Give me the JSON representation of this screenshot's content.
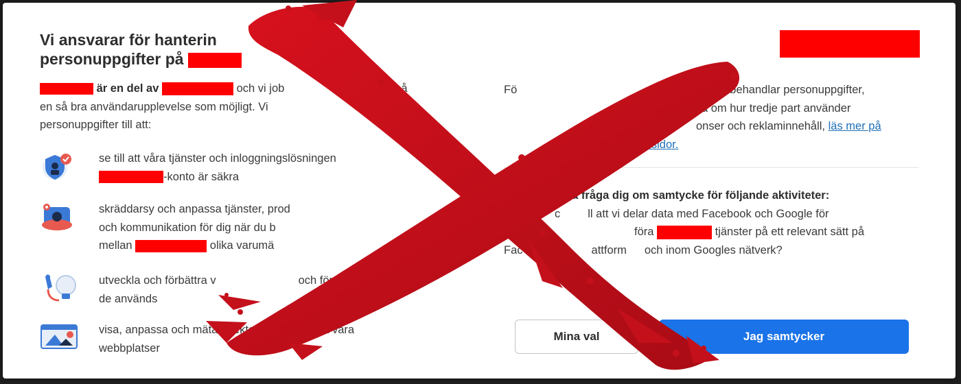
{
  "colors": {
    "redaction": "#ff0000",
    "primary_button": "#1a73e8",
    "link": "#1f6fb8",
    "overlay_x": "#c8101c"
  },
  "dialog": {
    "title_line1": "Vi ansvarar för hanterin",
    "title_line2": "personuppgifter på"
  },
  "intro": {
    "part1": "är en del av",
    "part2": "och vi job",
    "part3": "å",
    "line2": "en så bra användarupplevelse som möjligt. Vi",
    "line3": "personuppgifter till att:"
  },
  "purposes": [
    {
      "icon": "security-shield-icon",
      "line1": "se till att våra tjänster och inloggningslösningen",
      "line2_after": "-konto är säkra"
    },
    {
      "icon": "personalize-chat-icon",
      "line1": "skräddarsy och anpassa tjänster, prod",
      "line2": "och kommunikation för dig när du b",
      "line3_before": "mellan",
      "line3_after": "olika varumä"
    },
    {
      "icon": "improve-lightbulb-icon",
      "line1": "utveckla och förbättra v",
      "line1_tail": "och förstå hur",
      "line2": "de används"
    },
    {
      "icon": "advertising-screen-icon",
      "line1": "visa, anpassa och mäta effekten av reklam på våra",
      "line2": "webbplatser"
    }
  ],
  "right": {
    "line1_start": "Fö",
    "line1_end": "behandlar personuppgifter,",
    "line2_end": "a om hur tredje part använder",
    "line3_end": "onser och reklaminnehåll,",
    "link_line3": "läs mer på",
    "link_line4": "yddssidor."
  },
  "consent": {
    "question_bold": "så fråga dig om samtycke för följande aktiviteter:",
    "line2_start": "c",
    "line2_end": "ll att vi delar data med Facebook och Google för",
    "line3_mid": "föra",
    "line3_end": "tjänster på ett relevant sätt på",
    "line4_start": "Fac",
    "line4_mid": "attform",
    "line4_end": "och inom Googles nätverk?"
  },
  "buttons": {
    "my_choices": "Mina val",
    "accept": "Jag samtycker"
  }
}
